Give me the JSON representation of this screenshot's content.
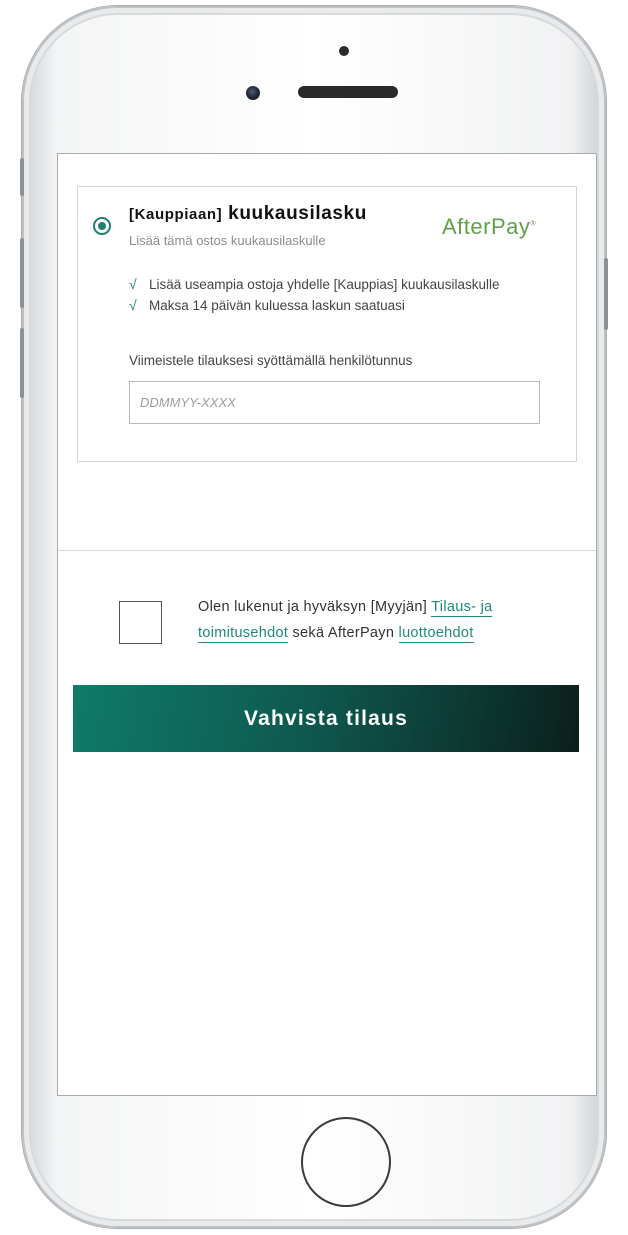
{
  "payment_option": {
    "title_prefix": "[Kauppiaan]",
    "title_main": "kuukausilasku",
    "subtitle": "Lisää tämä ostos kuukausilaskulle",
    "logo_text": "AfterPay",
    "logo_mark": "®",
    "benefits": [
      "Lisää useampia ostoja yhdelle [Kauppias] kuukausilaskulle",
      "Maksa 14 päivän kuluessa laskun saatuasi"
    ],
    "check_glyph": "√",
    "id_label": "Viimeistele tilauksesi syöttämällä henkilötunnus",
    "id_placeholder": "DDMMYY-XXXX",
    "id_value": ""
  },
  "terms": {
    "text_before": "Olen lukenut ja hyväksyn [Myyjän] ",
    "link_terms": "Tilaus- ja toimitusehdot",
    "text_middle": " sekä AfterPayn ",
    "link_credit": "luottoehdot",
    "checked": false
  },
  "confirm_button_label": "Vahvista tilaus",
  "colors": {
    "accent": "#1f7f72",
    "logo_green": "#5fa04a",
    "button_gradient_start": "#0f7a6b",
    "button_gradient_end": "#0b1f1c"
  },
  "icons": {
    "radio": "radio-selected-icon",
    "check": "check-icon"
  }
}
